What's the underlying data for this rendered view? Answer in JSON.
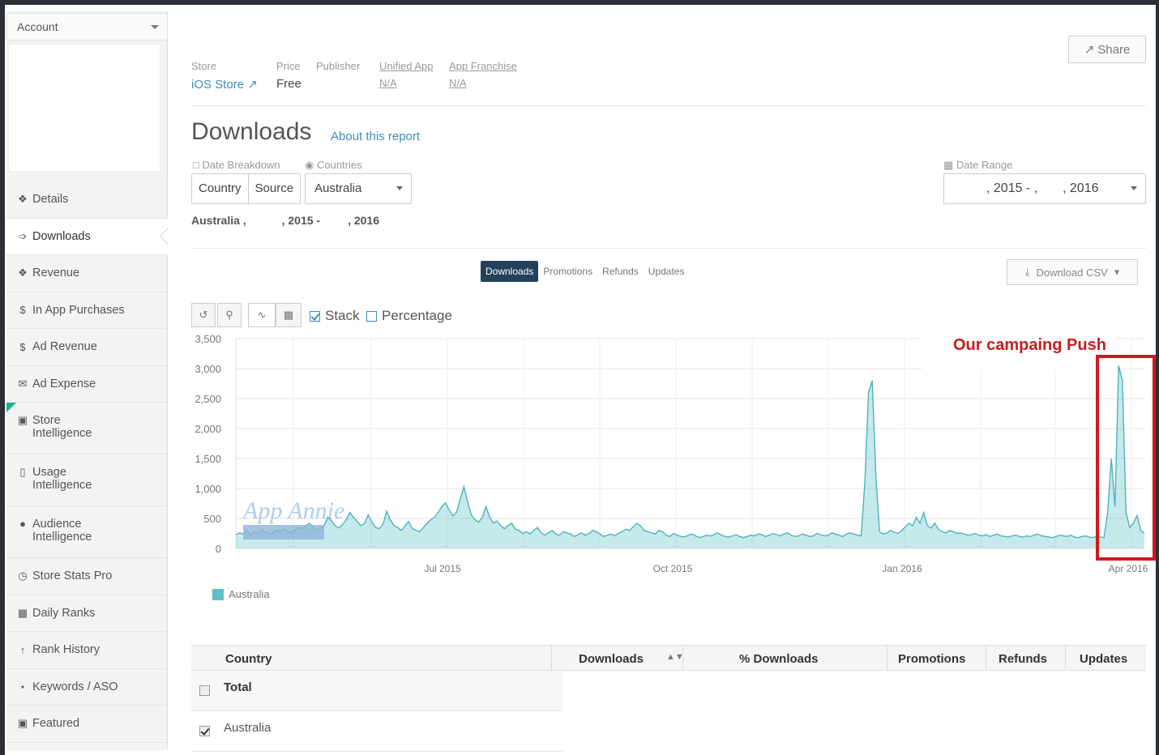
{
  "sidebar": {
    "account_label": "Account",
    "items": [
      {
        "label": "Details",
        "icon": "info-icon"
      },
      {
        "label": "Downloads",
        "icon": "download-icon",
        "active": true
      },
      {
        "label": "Revenue",
        "icon": "revenue-icon"
      },
      {
        "label": "In App Purchases",
        "icon": "dollar-icon"
      },
      {
        "label": "Ad Revenue",
        "icon": "ad-revenue-icon"
      },
      {
        "label": "Ad Expense",
        "icon": "megaphone-icon"
      },
      {
        "label": "Store",
        "label2": "Intelligence",
        "icon": "store-icon"
      },
      {
        "label": "Usage",
        "label2": "Intelligence",
        "icon": "phone-icon"
      },
      {
        "label": "Audience",
        "label2": "Intelligence",
        "icon": "person-icon"
      },
      {
        "label": "Store Stats Pro",
        "icon": "clock-icon"
      },
      {
        "label": "Daily Ranks",
        "icon": "calendar-icon"
      },
      {
        "label": "Rank History",
        "icon": "arrow-up-icon"
      },
      {
        "label": "Keywords / ASO",
        "icon": "key-icon"
      },
      {
        "label": "Featured",
        "icon": "bookmark-icon"
      }
    ]
  },
  "header": {
    "share_label": "Share",
    "meta": {
      "store_label": "Store",
      "store_value": "iOS Store",
      "price_label": "Price",
      "price_value": "Free",
      "publisher_label": "Publisher",
      "unified_label": "Unified App",
      "unified_value": "N/A",
      "franchise_label": "App Franchise",
      "franchise_value": "N/A"
    },
    "title": "Downloads",
    "about_link": "About this report"
  },
  "filters": {
    "breakdown_label": "Date Breakdown",
    "breakdown_options": [
      "Country",
      "Source"
    ],
    "countries_label": "Countries",
    "country_value": "Australia",
    "range_label": "Date Range",
    "range_part1": ", 2015 - ,",
    "range_part2": ", 2016",
    "subtitle_a": "Australia , ",
    "subtitle_b": ", 2015 -",
    "subtitle_c": ", 2016"
  },
  "tabs": [
    "Downloads",
    "Promotions",
    "Refunds",
    "Updates"
  ],
  "csv_label": "Download CSV",
  "chart_options": {
    "stack_label": "Stack",
    "stack_checked": true,
    "percentage_label": "Percentage",
    "percentage_checked": false
  },
  "annotation": "Our campaing Push",
  "watermark": "App Annie",
  "chart_data": {
    "type": "area",
    "y_ticks": [
      "3,500",
      "3,000",
      "2,500",
      "2,000",
      "1,500",
      "1,000",
      "500",
      "0"
    ],
    "ylim": [
      0,
      3500
    ],
    "x_tick_labels": [
      "Jul 2015",
      "Oct 2015",
      "Jan 2016",
      "Apr 2016"
    ],
    "series": [
      {
        "name": "Australia",
        "color": "#5bc0c8",
        "values": [
          230,
          260,
          240,
          300,
          220,
          280,
          250,
          310,
          270,
          240,
          260,
          300,
          280,
          320,
          290,
          260,
          300,
          350,
          330,
          380,
          420,
          360,
          300,
          330,
          380,
          520,
          460,
          380,
          340,
          400,
          480,
          600,
          520,
          450,
          380,
          420,
          560,
          440,
          350,
          330,
          400,
          620,
          480,
          380,
          350,
          300,
          380,
          450,
          330,
          300,
          280,
          350,
          420,
          480,
          520,
          600,
          700,
          760,
          640,
          540,
          600,
          820,
          1030,
          780,
          560,
          480,
          440,
          520,
          700,
          520,
          420,
          460,
          380,
          330,
          380,
          420,
          320,
          300,
          250,
          280,
          240,
          300,
          350,
          260,
          220,
          260,
          300,
          240,
          220,
          280,
          260,
          240,
          200,
          230,
          260,
          220,
          250,
          300,
          280,
          240,
          200,
          220,
          240,
          210,
          250,
          280,
          320,
          300,
          360,
          420,
          380,
          300,
          280,
          260,
          240,
          300,
          280,
          220,
          200,
          250,
          220,
          200,
          190,
          220,
          240,
          210,
          180,
          200,
          220,
          210,
          230,
          260,
          220,
          200,
          190,
          210,
          230,
          200,
          180,
          200,
          220,
          210,
          240,
          230,
          200,
          220,
          250,
          230,
          210,
          240,
          260,
          220,
          200,
          210,
          240,
          220,
          200,
          210,
          250,
          230,
          210,
          220,
          260,
          240,
          220,
          200,
          240,
          260,
          240,
          220,
          210,
          1100,
          2600,
          2800,
          1200,
          280,
          240,
          260,
          300,
          270,
          250,
          300,
          360,
          420,
          380,
          520,
          420,
          600,
          380,
          340,
          420,
          320,
          280,
          260,
          300,
          280,
          250,
          260,
          240,
          220,
          230,
          250,
          220,
          210,
          230,
          200,
          220,
          240,
          210,
          200,
          190,
          210,
          220,
          200,
          190,
          210,
          200,
          220,
          240,
          210,
          200,
          190,
          180,
          200,
          220,
          210,
          200,
          220,
          190,
          180,
          200,
          210,
          190,
          180,
          200,
          190,
          180,
          600,
          1500,
          700,
          3050,
          2800,
          600,
          350,
          420,
          550,
          300,
          250
        ]
      }
    ]
  },
  "legend_label": "Australia",
  "table": {
    "columns": [
      "Country",
      "Downloads",
      "% Downloads",
      "Promotions",
      "Refunds",
      "Updates"
    ],
    "rows": [
      {
        "name": "Total",
        "checked": false,
        "bold": true
      },
      {
        "name": "Australia",
        "checked": true,
        "bold": false
      }
    ]
  }
}
